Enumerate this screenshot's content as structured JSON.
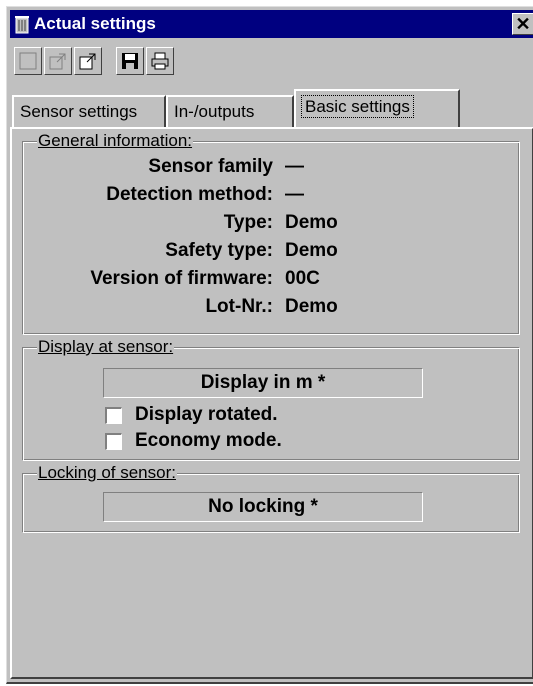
{
  "window": {
    "title": "Actual settings",
    "close_glyph": "✕"
  },
  "toolbar": {
    "buttons": [
      {
        "icon": "new-document-icon"
      },
      {
        "icon": "import-icon"
      },
      {
        "icon": "export-icon"
      },
      {
        "icon": "save-icon"
      },
      {
        "icon": "print-icon"
      }
    ]
  },
  "tabs": [
    "Sensor settings",
    "In-/outputs",
    "Basic settings"
  ],
  "active_tab": "Basic settings",
  "general": {
    "legend": "General information:",
    "rows": [
      {
        "label": "Sensor family",
        "value": "—"
      },
      {
        "label": "Detection method:",
        "value": "—"
      },
      {
        "label": "Type:",
        "value": "Demo"
      },
      {
        "label": "Safety type:",
        "value": "Demo"
      },
      {
        "label": "Version of firmware:",
        "value": "00C"
      },
      {
        "label": "Lot-Nr.:",
        "value": "Demo"
      }
    ]
  },
  "display": {
    "legend": "Display at sensor:",
    "field": "Display in m *",
    "options": [
      {
        "label": "Display rotated.",
        "checked": false
      },
      {
        "label": "Economy mode.",
        "checked": false
      }
    ]
  },
  "locking": {
    "legend": "Locking of sensor:",
    "field": "No locking *"
  }
}
